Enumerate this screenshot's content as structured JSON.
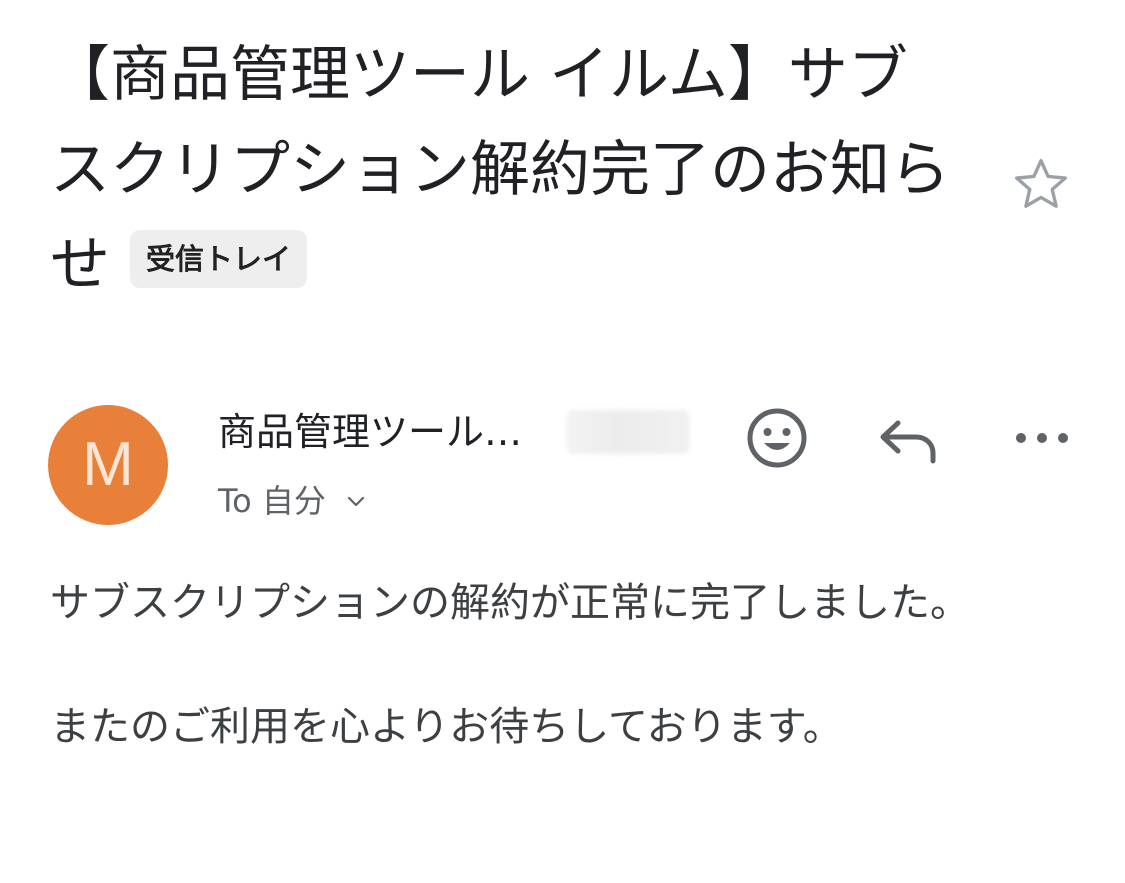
{
  "email": {
    "subject": "【商品管理ツール イルム】サブスクリプション解約完了のお知らせ",
    "label": "受信トレイ",
    "sender": {
      "avatar_letter": "M",
      "avatar_color": "#e8803a",
      "name": "商品管理ツール…"
    },
    "recipient": {
      "prefix": "To",
      "name": "自分"
    },
    "body": [
      "サブスクリプションの解約が正常に完了しました。",
      "またのご利用を心よりお待ちしております。"
    ]
  },
  "icons": {
    "star": "star-outline-icon",
    "emoji": "smiley-icon",
    "reply": "reply-arrow-icon",
    "more": "more-horizontal-icon",
    "chevron": "chevron-down-icon"
  }
}
